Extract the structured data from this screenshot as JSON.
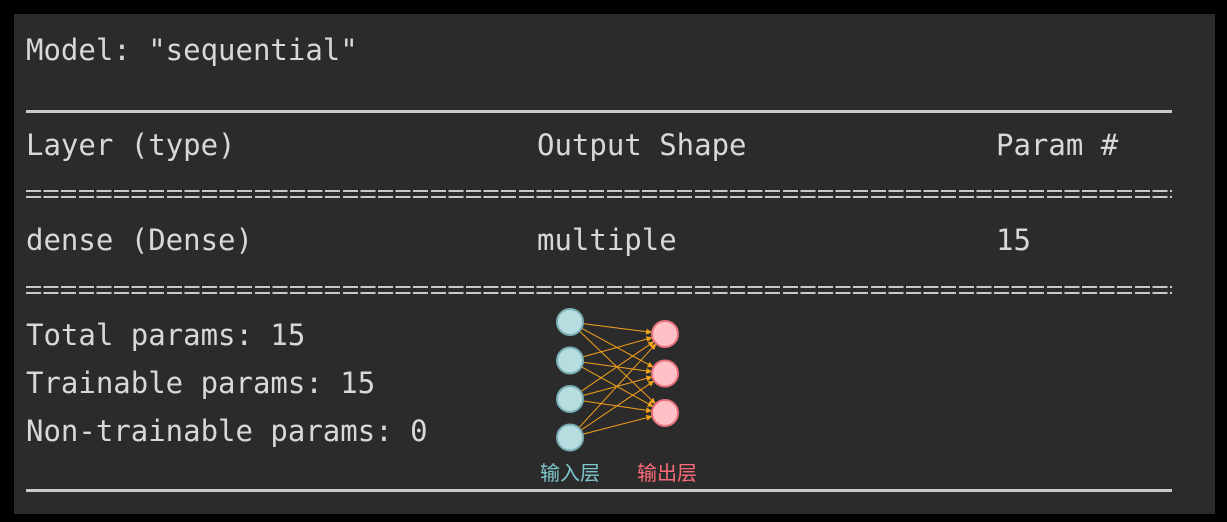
{
  "model": {
    "title": "Model: \"sequential\""
  },
  "table": {
    "headers": [
      "Layer (type)",
      "Output Shape",
      "Param #"
    ],
    "rows": [
      [
        "dense (Dense)",
        "multiple",
        "15"
      ]
    ]
  },
  "summary": {
    "total": "Total params: 15",
    "trainable": "Trainable params: 15",
    "non_trainable": "Non-trainable params: 0"
  },
  "diagram": {
    "input_label": "输入层",
    "output_label": "输出层",
    "input_nodes": 4,
    "output_nodes": 3,
    "colors": {
      "input_fill": "#b8dde1",
      "input_stroke": "#79aeb3",
      "output_fill": "#ffc0c6",
      "output_stroke": "#e8737f",
      "edge": "#f5a21b",
      "input_label": "#7fc7cd",
      "output_label": "#ff6b7a"
    }
  }
}
